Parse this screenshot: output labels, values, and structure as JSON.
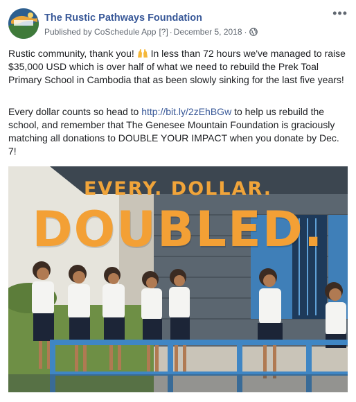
{
  "post": {
    "page_name": "The Rustic Pathways Foundation",
    "meta": {
      "published_by": "Published by CoSchedule App",
      "help_mark": "[?]",
      "separator": "·",
      "date": "December 5, 2018",
      "separator2": "·"
    },
    "more_label": "•••",
    "paragraph1": {
      "before_emoji": "Rustic community, thank you! ",
      "emoji": "raising-hands",
      "after_emoji": " In less than 72 hours we've managed to raise $35,000 USD which is over half of what we need to rebuild the Prek Toal Primary School in Cambodia that as been slowly sinking for the last five years!"
    },
    "paragraph2": {
      "before_link": "Every dollar counts so head to ",
      "link": "http://bit.ly/2zEhBGw",
      "after_link": " to help us rebuild the school, and remember that The Genesee Mountain Foundation is graciously matching all donations to DOUBLE YOUR IMPACT when you donate by Dec. 7!"
    },
    "image": {
      "headline_top": "EVERY. DOLLAR.",
      "headline_main": "DOUBLED."
    }
  },
  "colors": {
    "link": "#385898",
    "text": "#1c1e21",
    "meta": "#606770",
    "headline": "#f3a035"
  },
  "icons": {
    "avatar": "foundation-logo",
    "globe": "globe-icon",
    "more": "more-options-icon"
  }
}
